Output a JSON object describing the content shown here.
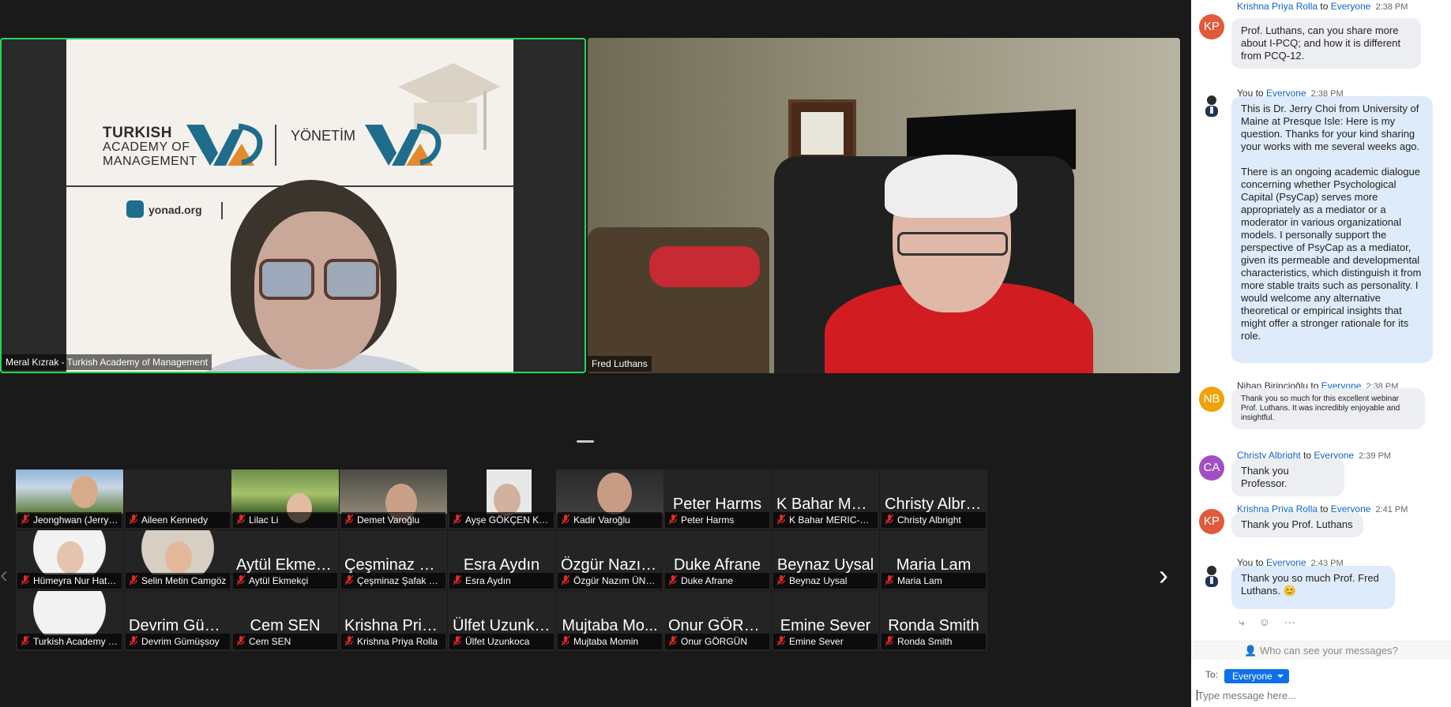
{
  "speakers": {
    "left_name": "Meral Kızrak - Turkish Academy of Management",
    "right_name": "Fred Luthans"
  },
  "slide": {
    "logo_line1": "TURKISH",
    "logo_line2": "ACADEMY OF",
    "logo_line3": "MANAGEMENT",
    "logo_right": "YÖNETİM",
    "url": "yonad.org"
  },
  "gallery": {
    "tiles": [
      {
        "big": "",
        "tag": "Jeonghwan (Jerry) C..."
      },
      {
        "big": "",
        "tag": "Aileen Kennedy"
      },
      {
        "big": "",
        "tag": "Lilac Li"
      },
      {
        "big": "",
        "tag": "Demet Varoğlu"
      },
      {
        "big": "",
        "tag": "Ayşe GÖKÇEN KAPU..."
      },
      {
        "big": "",
        "tag": "Kadir Varoğlu"
      },
      {
        "big": "Peter Harms",
        "tag": "Peter Harms"
      },
      {
        "big": "K Bahar MERI...",
        "tag": "K Bahar MERIC-ATAK..."
      },
      {
        "big": "Christy Albrig...",
        "tag": "Christy Albright"
      },
      {
        "big": "",
        "tag": "Hümeyra Nur Hatipo..."
      },
      {
        "big": "",
        "tag": "Selin Metin Camgöz"
      },
      {
        "big": "Aytül Ekmekçi",
        "tag": "Aytül Ekmekçi"
      },
      {
        "big": "Çeşminaz Şa...",
        "tag": "Çeşminaz Şafak Kum..."
      },
      {
        "big": "Esra Aydın",
        "tag": "Esra Aydın"
      },
      {
        "big": "Özgür Nazım...",
        "tag": "Özgür Nazım ÜNSAL"
      },
      {
        "big": "Duke Afrane",
        "tag": "Duke Afrane"
      },
      {
        "big": "Beynaz Uysal",
        "tag": "Beynaz Uysal"
      },
      {
        "big": "Maria Lam",
        "tag": "Maria Lam"
      },
      {
        "big": "",
        "tag": "Turkish Academy of..."
      },
      {
        "big": "Devrim Güm...",
        "tag": "Devrim Gümüşsoy"
      },
      {
        "big": "Cem SEN",
        "tag": "Cem SEN"
      },
      {
        "big": "Krishna Priya...",
        "tag": "Krishna Priya Rolla"
      },
      {
        "big": "Ülfet Uzunko...",
        "tag": "Ülfet Uzunkoca"
      },
      {
        "big": "Mujtaba Mo...",
        "tag": "Mujtaba Momin"
      },
      {
        "big": "Onur GÖRGÜN",
        "tag": "Onur GÖRGÜN"
      },
      {
        "big": "Emine Sever",
        "tag": "Emine Sever"
      },
      {
        "big": "Ronda Smith",
        "tag": "Ronda Smith"
      }
    ],
    "prev_icon": "chevron-left-icon",
    "next_icon": "chevron-right-icon"
  },
  "chat": {
    "messages": [
      {
        "avatar": "KP",
        "avatar_color": "#e05a3b",
        "sender": "Krishna Priya Rolla",
        "to": "to",
        "recipient": "Everyone",
        "time": "2:38 PM",
        "body": "Prof. Luthans, can you share more about I-PCQ; and how it is different from PCQ-12."
      },
      {
        "avatar": "",
        "avatar_color": "#2a3e52",
        "sender": "You",
        "to": "to",
        "recipient": "Everyone",
        "time": "2:38 PM",
        "body": "This is Dr. Jerry Choi from University of Maine at Presque Isle: Here is my question. Thanks for your kind sharing your works with me several weeks ago.",
        "body2": "There is an ongoing academic dialogue concerning whether Psychological Capital (PsyCap) serves more appropriately as a mediator or a moderator in various organizational models. I personally support the perspective of PsyCap as a mediator, given its permeable and developmental characteristics, which distinguish it from more stable traits such as personality. I would welcome any alternative theoretical or empirical insights that might offer a stronger rationale for its role."
      },
      {
        "avatar": "NB",
        "avatar_color": "#f0a20a",
        "sender": "Nihan Birincioğlu",
        "to": "to",
        "recipient": "Everyone",
        "time": "2:38 PM",
        "body": "Thank you so much for this excellent webinar Prof. Luthans. It was incredibly enjoyable and insightful."
      },
      {
        "avatar": "CA",
        "avatar_color": "#a04fc4",
        "sender": "Christy Albright",
        "to": "to",
        "recipient": "Everyone",
        "time": "2:39 PM",
        "body": "Thank you Professor."
      },
      {
        "avatar": "KP",
        "avatar_color": "#e05a3b",
        "sender": "Krishna Priya Rolla",
        "to": "to",
        "recipient": "Everyone",
        "time": "2:41 PM",
        "body": "Thank you Prof. Luthans"
      },
      {
        "avatar": "",
        "avatar_color": "#2a3e52",
        "sender": "You",
        "to": "to",
        "recipient": "Everyone",
        "time": "2:43 PM",
        "body": "Thank you so much Prof. Fred Luthans. 😊"
      }
    ],
    "who_can_see": "Who can see your messages?",
    "to_label": "To:",
    "to_value": "Everyone",
    "input_placeholder": "Type message here...",
    "action_icons": [
      "reply-icon",
      "emoji-reaction-icon",
      "more-icon"
    ]
  }
}
